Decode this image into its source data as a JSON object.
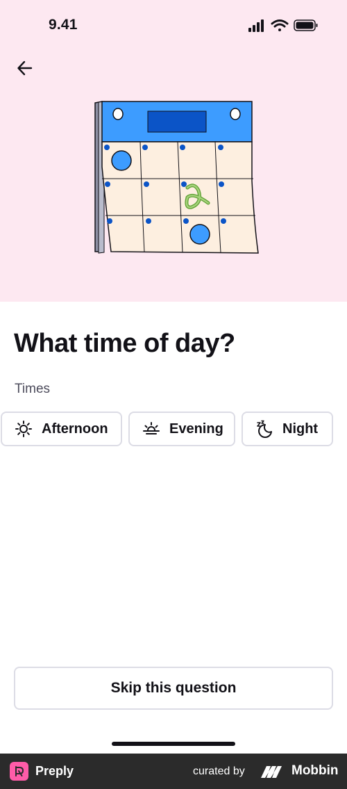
{
  "status_bar": {
    "time": "9.41"
  },
  "header": {
    "back_icon": "arrow-left-icon"
  },
  "hero": {
    "illustration": "calendar-illustration",
    "accent_color": "#fde8f1"
  },
  "main": {
    "title": "What time of day?",
    "section_label": "Times",
    "options": [
      {
        "label": "Afternoon",
        "icon": "sun-icon"
      },
      {
        "label": "Evening",
        "icon": "sunset-icon"
      },
      {
        "label": "Night",
        "icon": "moon-sleep-icon"
      }
    ]
  },
  "actions": {
    "skip_label": "Skip this question"
  },
  "footer": {
    "brand": "Preply",
    "curated_by": "curated by",
    "curator": "Mobbin",
    "brand_color": "#ff5ca8"
  }
}
